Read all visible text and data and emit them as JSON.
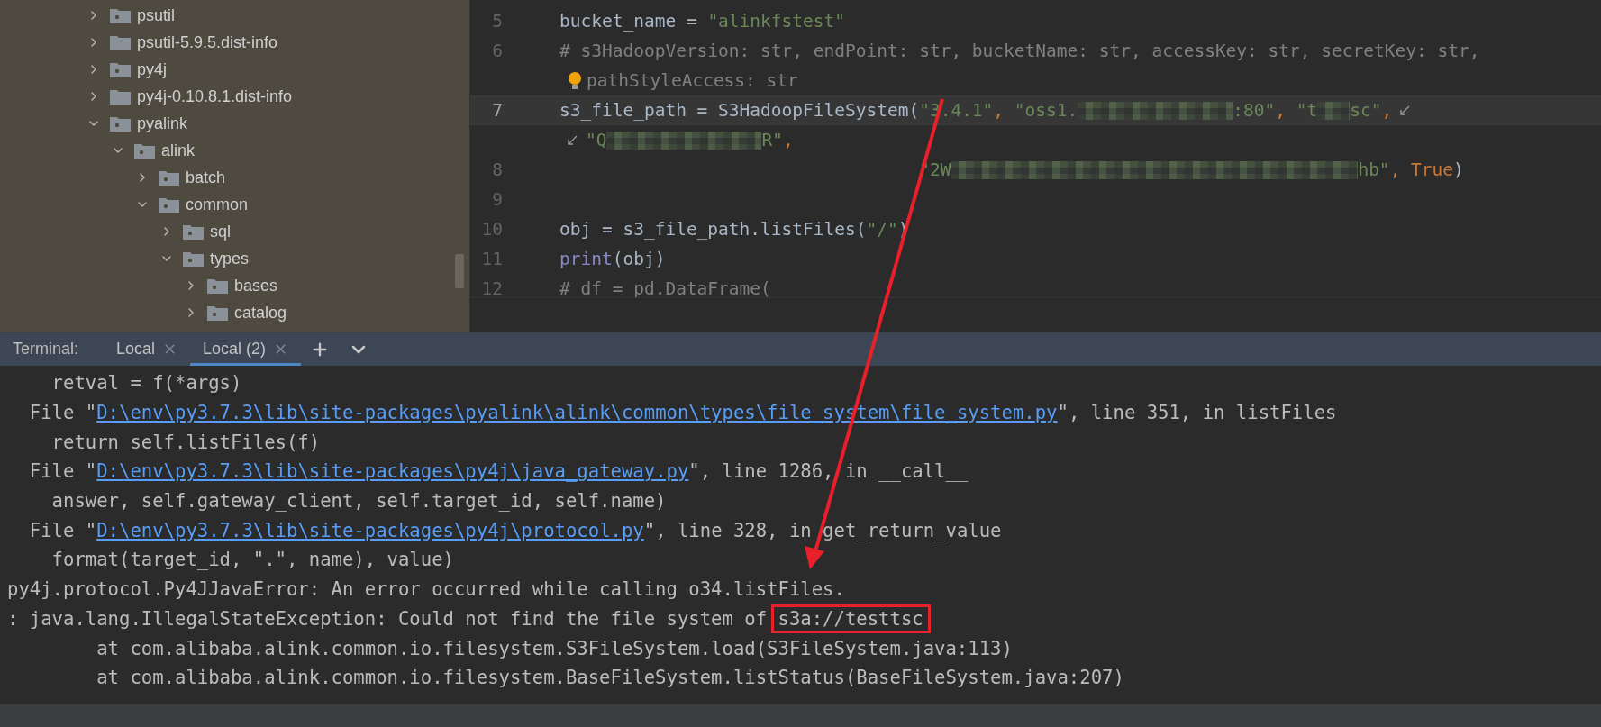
{
  "project_tree": {
    "items": [
      {
        "label": "psutil",
        "kind": "package",
        "expanded": false
      },
      {
        "label": "psutil-5.9.5.dist-info",
        "kind": "folder",
        "expanded": false
      },
      {
        "label": "py4j",
        "kind": "package",
        "expanded": false
      },
      {
        "label": "py4j-0.10.8.1.dist-info",
        "kind": "folder",
        "expanded": false
      },
      {
        "label": "pyalink",
        "kind": "package",
        "expanded": true,
        "children": [
          {
            "label": "alink",
            "kind": "package",
            "expanded": true,
            "children": [
              {
                "label": "batch",
                "kind": "package",
                "expanded": false
              },
              {
                "label": "common",
                "kind": "package",
                "expanded": true,
                "children": [
                  {
                    "label": "sql",
                    "kind": "package",
                    "expanded": false
                  },
                  {
                    "label": "types",
                    "kind": "package",
                    "expanded": true,
                    "children": [
                      {
                        "label": "bases",
                        "kind": "package",
                        "expanded": false
                      },
                      {
                        "label": "catalog",
                        "kind": "package",
                        "expanded": false
                      }
                    ]
                  }
                ]
              }
            ]
          }
        ]
      }
    ]
  },
  "editor": {
    "lines": [
      {
        "number": "5",
        "current": false,
        "tokens": [
          {
            "kind": "plain",
            "text": "bucket_name = "
          },
          {
            "kind": "string",
            "text": "\"alinkfstest\""
          }
        ]
      },
      {
        "number": "6",
        "current": false,
        "tokens": [
          {
            "kind": "comment",
            "text": "# s3HadoopVersion: str, endPoint: str, bucketName: str, accessKey: str, secretKey: str,"
          }
        ]
      },
      {
        "current": false,
        "intention_bulb": true,
        "tokens": [
          {
            "kind": "comment",
            "text": "pathStyleAccess: str"
          }
        ]
      },
      {
        "number": "7",
        "current": true,
        "tokens": [
          {
            "kind": "plain",
            "text": "s3_file_path = S3HadoopFileSystem("
          },
          {
            "kind": "string",
            "text": "\"3.4.1\""
          },
          {
            "kind": "punct",
            "text": ", "
          },
          {
            "kind": "string",
            "text": "\"oss1."
          },
          {
            "kind": "blur_medium"
          },
          {
            "kind": "string",
            "text": ":80\""
          },
          {
            "kind": "punct",
            "text": ", "
          },
          {
            "kind": "string",
            "text": "\"t"
          },
          {
            "kind": "blur_short"
          },
          {
            "kind": "string",
            "text": "sc\""
          },
          {
            "kind": "punct",
            "text": ","
          },
          {
            "kind": "wrap"
          }
        ]
      },
      {
        "current": false,
        "tokens": [
          {
            "kind": "wrap"
          },
          {
            "kind": "string",
            "text": "\"Q"
          },
          {
            "kind": "blur_medium"
          },
          {
            "kind": "string",
            "text": "R\""
          },
          {
            "kind": "punct",
            "text": ","
          }
        ]
      },
      {
        "number": "8",
        "current": false,
        "tokens": [
          {
            "kind": "string",
            "text": "                                  \"2W"
          },
          {
            "kind": "blur_long"
          },
          {
            "kind": "string",
            "text": "hb\""
          },
          {
            "kind": "punct",
            "text": ", "
          },
          {
            "kind": "keyword",
            "text": "True"
          },
          {
            "kind": "plain",
            "text": ")"
          }
        ]
      },
      {
        "number": "9",
        "current": false
      },
      {
        "number": "10",
        "current": false,
        "tokens": [
          {
            "kind": "plain",
            "text": "obj = s3_file_path.listFiles("
          },
          {
            "kind": "string",
            "text": "\"/\""
          },
          {
            "kind": "plain",
            "text": ")"
          }
        ]
      },
      {
        "number": "11",
        "current": false,
        "tokens": [
          {
            "kind": "builtin",
            "text": "print"
          },
          {
            "kind": "plain",
            "text": "(obj)"
          }
        ]
      },
      {
        "number": "12",
        "current": false,
        "tokens": [
          {
            "kind": "comment",
            "text": "# df = pd.DataFrame("
          }
        ]
      }
    ]
  },
  "terminal": {
    "label": "Terminal:",
    "tabs": [
      {
        "label": "Local",
        "selected": false
      },
      {
        "label": "Local (2)",
        "selected": true
      }
    ],
    "lines": [
      [
        {
          "kind": "plain",
          "text": "    retval = f(*args)"
        }
      ],
      [
        {
          "kind": "plain",
          "text": "  File \""
        },
        {
          "kind": "link",
          "text": "D:\\env\\py3.7.3\\lib\\site-packages\\pyalink\\alink\\common\\types\\file_system\\file_system.py"
        },
        {
          "kind": "plain",
          "text": "\", line 351, in listFiles"
        }
      ],
      [
        {
          "kind": "plain",
          "text": "    return self.listFiles(f)"
        }
      ],
      [
        {
          "kind": "plain",
          "text": "  File \""
        },
        {
          "kind": "link",
          "text": "D:\\env\\py3.7.3\\lib\\site-packages\\py4j\\java_gateway.py"
        },
        {
          "kind": "plain",
          "text": "\", line 1286, in __call__"
        }
      ],
      [
        {
          "kind": "plain",
          "text": "    answer, self.gateway_client, self.target_id, self.name)"
        }
      ],
      [
        {
          "kind": "plain",
          "text": "  File \""
        },
        {
          "kind": "link",
          "text": "D:\\env\\py3.7.3\\lib\\site-packages\\py4j\\protocol.py"
        },
        {
          "kind": "plain",
          "text": "\", line 328, in get_return_value"
        }
      ],
      [
        {
          "kind": "plain",
          "text": "    format(target_id, \".\", name), value)"
        }
      ],
      [
        {
          "kind": "plain",
          "text": "py4j.protocol.Py4JJavaError: An error occurred while calling o34.listFiles."
        }
      ],
      [
        {
          "kind": "plain",
          "text": ": java.lang.IllegalStateException: Could not find the file system of "
        },
        {
          "kind": "boxed",
          "text": "s3a://testtsc"
        }
      ],
      [
        {
          "kind": "plain",
          "text": "        at com.alibaba.alink.common.io.filesystem.S3FileSystem.load(S3FileSystem.java:113)"
        }
      ],
      [
        {
          "kind": "plain",
          "text": "        at com.alibaba.alink.common.io.filesystem.BaseFileSystem.listStatus(BaseFileSystem.java:207)"
        }
      ]
    ]
  },
  "annotation_arrow": true
}
